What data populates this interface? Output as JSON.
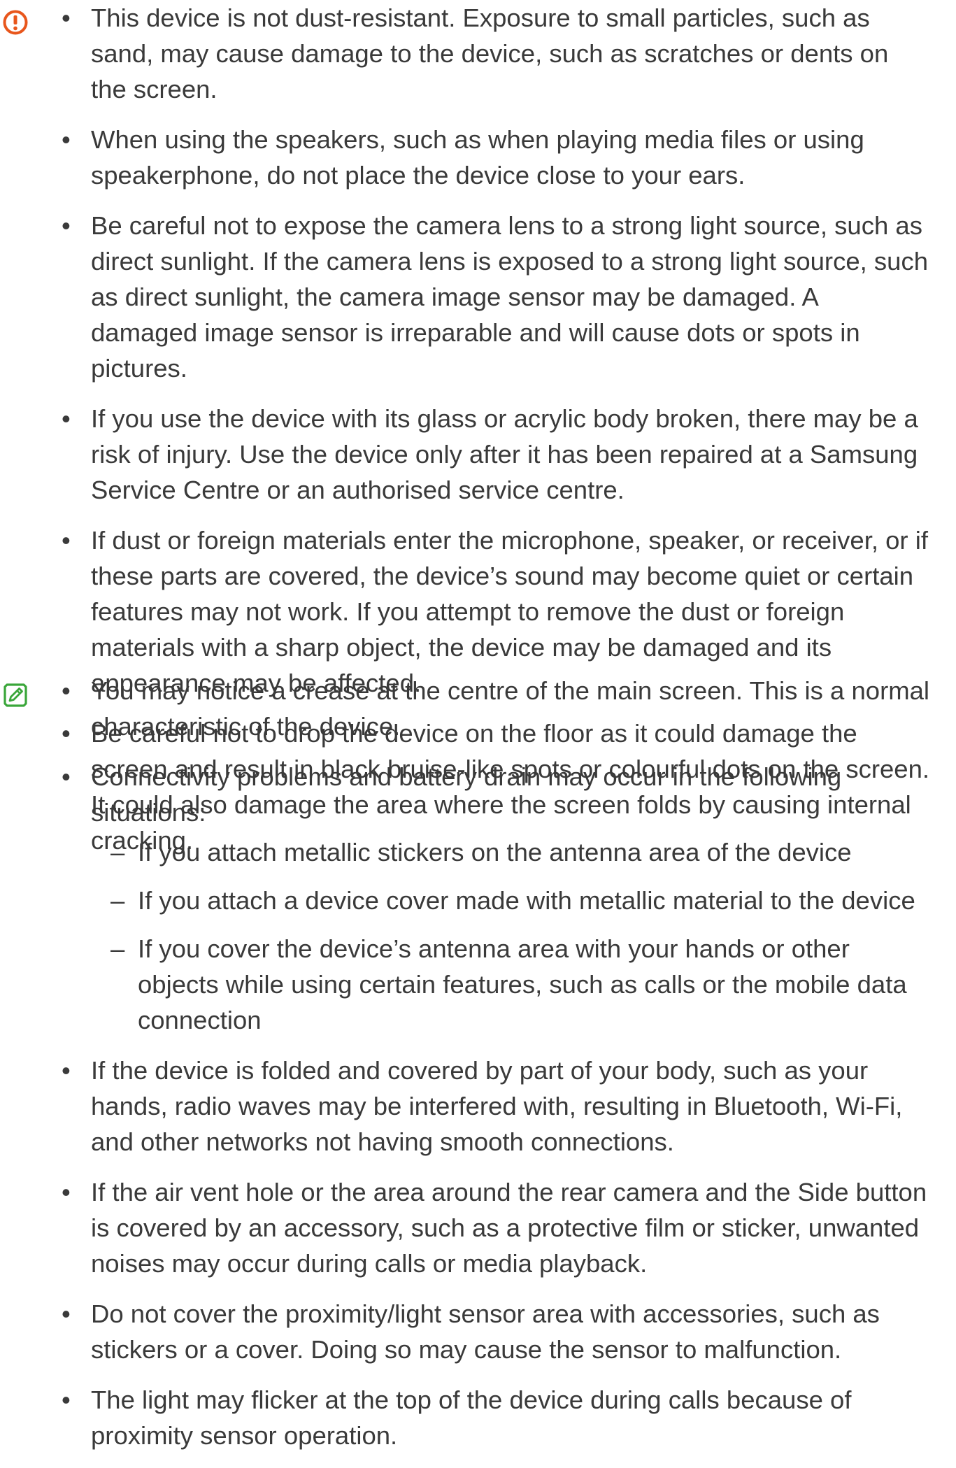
{
  "caution": {
    "icon": "caution-icon",
    "icon_color": "#e8561c",
    "items": [
      "This device is not dust-resistant. Exposure to small particles, such as sand, may cause damage to the device, such as scratches or dents on the screen.",
      "When using the speakers, such as when playing media files or using speakerphone, do not place the device close to your ears.",
      "Be careful not to expose the camera lens to a strong light source, such as direct sunlight. If the camera lens is exposed to a strong light source, such as direct sunlight, the camera image sensor may be damaged. A damaged image sensor is irreparable and will cause dots or spots in pictures.",
      "If you use the device with its glass or acrylic body broken, there may be a risk of injury. Use the device only after it has been repaired at a Samsung Service Centre or an authorised service centre.",
      "If dust or foreign materials enter the microphone, speaker, or receiver, or if these parts are covered, the device’s sound may become quiet or certain features may not work. If you attempt to remove the dust or foreign materials with a sharp object, the device may be damaged and its appearance may be affected.",
      "Be careful not to drop the device on the floor as it could damage the screen and result in black bruise-like spots or colourful dots on the screen. It could also damage the area where the screen folds by causing internal cracking."
    ]
  },
  "note": {
    "icon": "note-icon",
    "icon_color": "#3aa63a",
    "items": [
      "You may notice a crease at the centre of the main screen. This is a normal characteristic of the device.",
      "Connectivity problems and battery drain may occur in the following situations:",
      "If the device is folded and covered by part of your body, such as your hands, radio waves may be interfered with, resulting in Bluetooth, Wi-Fi, and other networks not having smooth connections.",
      "If the air vent hole or the area around the rear camera and the Side button is covered by an accessory, such as a protective film or sticker, unwanted noises may occur during calls or media playback.",
      "Do not cover the proximity/light sensor area with accessories, such as stickers or a cover. Doing so may cause the sensor to malfunction.",
      "The light may flicker at the top of the device during calls because of proximity sensor operation."
    ],
    "subitems": [
      "If you attach metallic stickers on the antenna area of the device",
      "If you attach a device cover made with metallic material to the device",
      "If you cover the device’s antenna area with your hands or other objects while using certain features, such as calls or the mobile data connection"
    ]
  }
}
